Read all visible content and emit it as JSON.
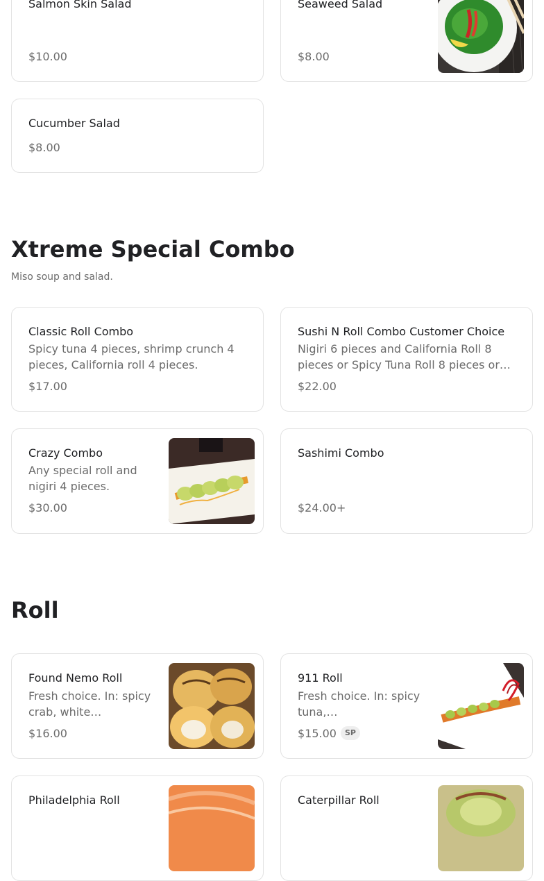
{
  "sections": {
    "salad": {
      "items": [
        {
          "name": "Salmon Skin Salad",
          "price": "$10.00"
        },
        {
          "name": "Seaweed Salad",
          "price": "$8.00"
        },
        {
          "name": "Cucumber Salad",
          "price": "$8.00"
        }
      ]
    },
    "xtreme": {
      "title": "Xtreme Special Combo",
      "subtitle": "Miso soup and salad.",
      "items": [
        {
          "name": "Classic Roll Combo",
          "description": "Spicy tuna 4 pieces, shrimp crunch 4 pieces, California roll 4 pieces.",
          "price": "$17.00"
        },
        {
          "name": "Sushi N Roll Combo Customer Choice",
          "description": "Nigiri 6 pieces and California Roll 8 pieces or Spicy Tuna Roll 8 pieces or…",
          "price": "$22.00"
        },
        {
          "name": "Crazy Combo",
          "description": "Any special roll and nigiri 4 pieces.",
          "price": "$30.00"
        },
        {
          "name": "Sashimi Combo",
          "price": "$24.00+"
        }
      ]
    },
    "roll": {
      "title": "Roll",
      "items": [
        {
          "name": "Found Nemo Roll",
          "description": "Fresh choice. In: spicy crab, white…",
          "price": "$16.00"
        },
        {
          "name": "911 Roll",
          "description": "Fresh choice. In: spicy tuna,…",
          "price": "$15.00",
          "badge": "SP"
        },
        {
          "name": "Philadelphia Roll"
        },
        {
          "name": "Caterpillar Roll"
        }
      ]
    }
  }
}
